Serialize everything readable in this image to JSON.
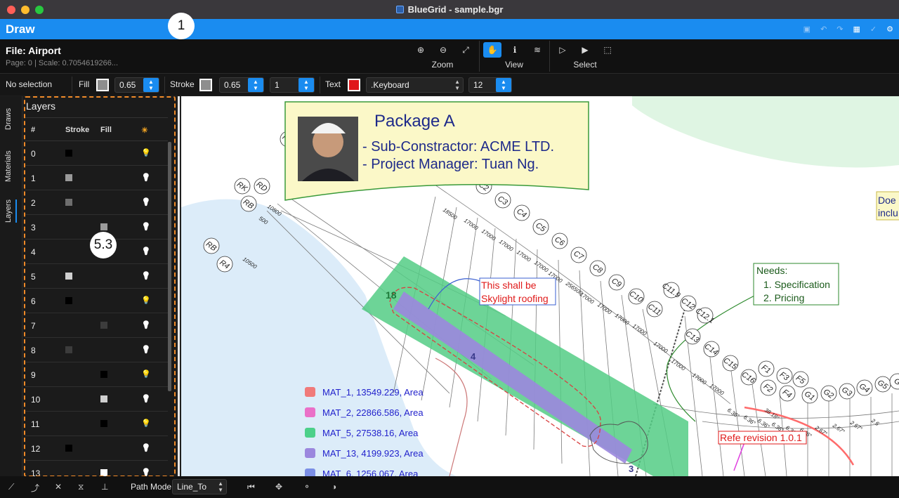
{
  "window": {
    "title": "BlueGrid - sample.bgr"
  },
  "app": {
    "mode_title": "Draw",
    "colors": {
      "accent": "#1a8cf0",
      "highlight": "#f08a28"
    }
  },
  "annotations": {
    "badge_1": "1",
    "badge_2": "5.3"
  },
  "file": {
    "name": "File: Airport",
    "meta": "Page: 0 | Scale: 0.7054619266..."
  },
  "toolbar": {
    "groups": [
      {
        "label": "Zoom",
        "icons": [
          "zoom-in-icon",
          "zoom-out-icon",
          "fit-icon"
        ]
      },
      {
        "label": "View",
        "icons": [
          "hand-icon",
          "info-icon",
          "layers-icon"
        ]
      },
      {
        "label": "Select",
        "icons": [
          "pointer-outline-icon",
          "pointer-icon",
          "select-box-icon"
        ]
      }
    ]
  },
  "style": {
    "selection": "No selection",
    "fill_label": "Fill",
    "fill_color": "#8e8e8e",
    "fill_opacity": "0.65",
    "stroke_label": "Stroke",
    "stroke_color": "#8e8e8e",
    "stroke_opacity": "0.65",
    "stroke_width": "1",
    "text_label": "Text",
    "text_color": "#e0161a",
    "font": ".Keyboard",
    "font_size": "12"
  },
  "side_tabs": [
    "Draws",
    "Materials",
    "Layers"
  ],
  "layers": {
    "title": "Layers",
    "columns": [
      "#",
      "Stroke",
      "Fill"
    ],
    "rows": [
      {
        "id": "0",
        "stroke": "#000000",
        "fill": "",
        "bulb": "#f5a623"
      },
      {
        "id": "1",
        "stroke": "#9a9a9a",
        "fill": "",
        "bulb": "#ffffff"
      },
      {
        "id": "2",
        "stroke": "#6e6e6e",
        "fill": "",
        "bulb": "#ffffff"
      },
      {
        "id": "3",
        "stroke": "",
        "fill": "#9a9a9a",
        "bulb": "#ffffff"
      },
      {
        "id": "4",
        "stroke": "",
        "fill": "",
        "bulb": "#ffffff"
      },
      {
        "id": "5",
        "stroke": "#cfcfcf",
        "fill": "",
        "bulb": "#ffffff"
      },
      {
        "id": "6",
        "stroke": "#000000",
        "fill": "",
        "bulb": "#f5a623"
      },
      {
        "id": "7",
        "stroke": "",
        "fill": "#3c3c3c",
        "bulb": "#ffffff"
      },
      {
        "id": "8",
        "stroke": "#3c3c3c",
        "fill": "",
        "bulb": "#ffffff"
      },
      {
        "id": "9",
        "stroke": "",
        "fill": "#000000",
        "bulb": "#f5a623"
      },
      {
        "id": "10",
        "stroke": "",
        "fill": "#cfcfcf",
        "bulb": "#ffffff"
      },
      {
        "id": "11",
        "stroke": "",
        "fill": "#000000",
        "bulb": "#f5a623"
      },
      {
        "id": "12",
        "stroke": "#000000",
        "fill": "",
        "bulb": "#ffffff"
      },
      {
        "id": "13",
        "stroke": "",
        "fill": "#ffffff",
        "bulb": "#ffffff"
      }
    ]
  },
  "drawing": {
    "package_title": "Package A",
    "package_line1": "- Sub-Constractor: ACME LTD.",
    "package_line2": "- Project Manager:  Tuan Ng.",
    "skylight_line1": "This shall be",
    "skylight_line2": "Skylight roofing",
    "needs_title": "Needs:",
    "needs_1": "1. Specification",
    "needs_2": "2. Pricing",
    "revision": "Refe revision 1.0.1",
    "cut_note_1": "Doe",
    "cut_note_2": "inclu",
    "zone_numbers": [
      "18",
      "4",
      "3"
    ],
    "materials": [
      {
        "label": "MAT_1, 13549.229, Area",
        "color": "#f07a7a"
      },
      {
        "label": "MAT_2, 22866.586, Area",
        "color": "#ea70c8"
      },
      {
        "label": "MAT_5, 27538.16, Area",
        "color": "#4cd08a"
      },
      {
        "label": "MAT_13, 4199.923, Area",
        "color": "#9b87de"
      },
      {
        "label": "MAT_6, 1256.067, Area",
        "color": "#7b8fe6"
      }
    ],
    "grid_labels": [
      "RD",
      "RK",
      "RD",
      "RB",
      "RB",
      "R4",
      "C2",
      "C3",
      "C4",
      "C5",
      "C6",
      "C7",
      "C8",
      "C9",
      "C10",
      "C11",
      "C11.9",
      "C12",
      "C12.1",
      "C13",
      "C14",
      "C15",
      "C16",
      "F1",
      "F2",
      "F3",
      "F4",
      "F5",
      "G1",
      "G2",
      "G3",
      "G4",
      "G5",
      "G"
    ],
    "dims": [
      "18500",
      "17000",
      "17000",
      "17000",
      "17000",
      "17000",
      "17000",
      "256500",
      "17000",
      "17000",
      "17000",
      "17000",
      "17000",
      "17000",
      "17000",
      "17000",
      "10800",
      "500",
      "10500",
      "38.18°",
      "6.36°",
      "6.36°",
      "6.36°",
      "6.36°",
      "6.36°",
      "6.36°",
      "2.67°",
      "2.67°",
      "2.67°",
      "2.6"
    ]
  },
  "bottom": {
    "path_mode_label": "Path Mode",
    "path_mode_value": "Line_To",
    "tools": [
      "line-tool-icon",
      "curve-tool-icon",
      "cross-tool-icon",
      "hourglass-tool-icon",
      "perpendicular-tool-icon"
    ],
    "actions": [
      "skip-back-icon",
      "move-icon",
      "nodes-icon",
      "contrast-icon"
    ]
  }
}
